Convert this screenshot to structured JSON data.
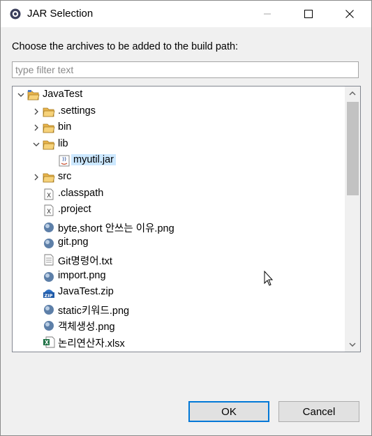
{
  "window": {
    "title": "JAR Selection",
    "icon": "eclipse-gear-icon",
    "controls": [
      "minimize-icon",
      "maximize-icon",
      "close-icon"
    ]
  },
  "prompt": "Choose the archives to be added to the build path:",
  "filter": {
    "placeholder": "type filter text",
    "value": ""
  },
  "tree": {
    "items": [
      {
        "label": "JavaTest",
        "icon": "open-project-folder-icon",
        "level": 0,
        "expanded": true
      },
      {
        "label": ".settings",
        "icon": "folder-icon",
        "level": 1,
        "expanded": false
      },
      {
        "label": "bin",
        "icon": "folder-icon",
        "level": 1,
        "expanded": false
      },
      {
        "label": "lib",
        "icon": "folder-icon",
        "level": 1,
        "expanded": true
      },
      {
        "label": "myutil.jar",
        "icon": "jar-icon",
        "level": 2,
        "selected": true
      },
      {
        "label": "src",
        "icon": "folder-icon",
        "level": 1,
        "expanded": false
      },
      {
        "label": ".classpath",
        "icon": "xml-file-icon",
        "level": 1
      },
      {
        "label": ".project",
        "icon": "xml-file-icon",
        "level": 1
      },
      {
        "label": "byte,short 안쓰는 이유.png",
        "icon": "image-file-icon",
        "level": 1
      },
      {
        "label": "git.png",
        "icon": "image-file-icon",
        "level": 1
      },
      {
        "label": "Git명령어.txt",
        "icon": "text-file-icon",
        "level": 1
      },
      {
        "label": "import.png",
        "icon": "image-file-icon",
        "level": 1
      },
      {
        "label": "JavaTest.zip",
        "icon": "zip-file-icon",
        "level": 1
      },
      {
        "label": "static키워드.png",
        "icon": "image-file-icon",
        "level": 1
      },
      {
        "label": "객체생성.png",
        "icon": "image-file-icon",
        "level": 1
      },
      {
        "label": "논리연산자.xlsx",
        "icon": "excel-file-icon",
        "level": 1
      }
    ]
  },
  "buttons": {
    "ok": "OK",
    "cancel": "Cancel"
  },
  "colors": {
    "selection": "#cce8ff",
    "default_button_border": "#0078d7",
    "folder": "#e8b44c"
  }
}
